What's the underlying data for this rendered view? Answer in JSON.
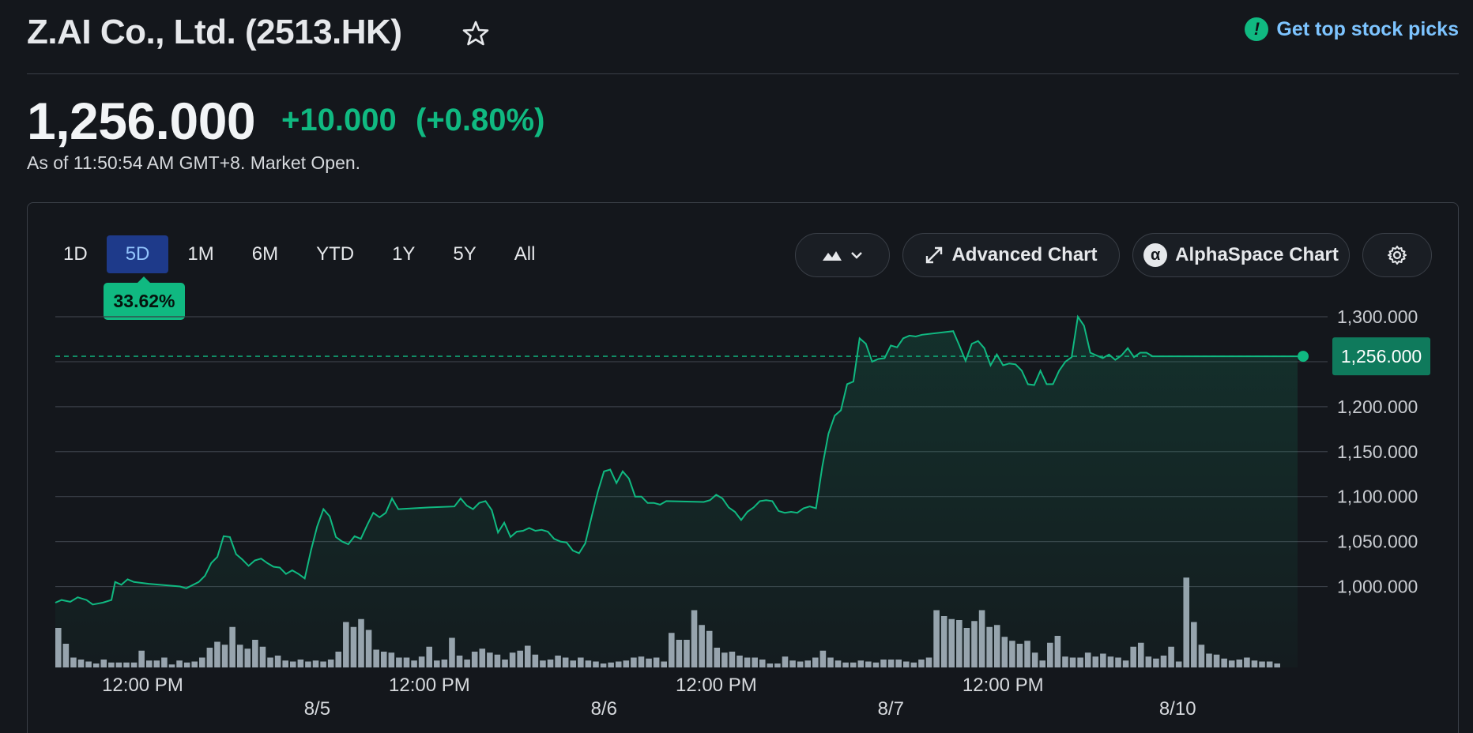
{
  "header": {
    "title": "Z.AI Co., Ltd. (2513.HK)",
    "picks_label": "Get top stock picks"
  },
  "quote": {
    "price": "1,256.000",
    "change": "+10.000",
    "change_pct": "(+0.80%)",
    "as_of": "As of 11:50:54 AM GMT+8. Market Open."
  },
  "tabs": [
    "1D",
    "5D",
    "1M",
    "6M",
    "YTD",
    "1Y",
    "5Y",
    "All"
  ],
  "active_tab": "5D",
  "tooltip": "33.62%",
  "buttons": {
    "advanced": "Advanced Chart",
    "alphaspace": "AlphaSpace Chart"
  },
  "icons": {
    "star": "star-icon",
    "picks": "exclamation-badge-icon",
    "chart_type": "mountain-chart-icon",
    "expand": "expand-arrows-icon",
    "alpha": "alpha-icon",
    "settings": "gear-icon"
  },
  "colors": {
    "up": "#10b981",
    "line": "#10b981",
    "volume": "#9ca3af",
    "grid": "#3a3f47",
    "link": "#7dc4ff",
    "active_tab_bg": "#1e3a8a",
    "active_tab_text": "#93c5fd"
  },
  "chart_data": {
    "type": "area",
    "y_ticks": [
      1000,
      1050,
      1100,
      1150,
      1200,
      1250,
      1300
    ],
    "y_tick_labels": [
      "1,000.000",
      "1,050.000",
      "1,100.000",
      "1,150.000",
      "1,200.000",
      "",
      "1,300.000"
    ],
    "ylim": [
      975,
      1300
    ],
    "current_price": 1256,
    "current_price_label": "1,256.000",
    "x_time_labels": [
      {
        "t": 0.07,
        "label": "12:00 PM"
      },
      {
        "t": 0.3,
        "label": "12:00 PM"
      },
      {
        "t": 0.53,
        "label": "12:00 PM"
      },
      {
        "t": 0.76,
        "label": "12:00 PM"
      }
    ],
    "x_date_labels": [
      {
        "t": 0.21,
        "label": "8/5"
      },
      {
        "t": 0.44,
        "label": "8/6"
      },
      {
        "t": 0.67,
        "label": "8/7"
      },
      {
        "t": 0.9,
        "label": "8/10"
      }
    ],
    "price_series": [
      [
        0.0,
        982
      ],
      [
        0.005,
        985
      ],
      [
        0.012,
        983
      ],
      [
        0.018,
        988
      ],
      [
        0.025,
        985
      ],
      [
        0.03,
        980
      ],
      [
        0.038,
        982
      ],
      [
        0.045,
        985
      ],
      [
        0.048,
        1005
      ],
      [
        0.053,
        1002
      ],
      [
        0.058,
        1008
      ],
      [
        0.063,
        1005
      ],
      [
        0.075,
        1003
      ],
      [
        0.1,
        1000
      ],
      [
        0.105,
        998
      ],
      [
        0.115,
        1005
      ],
      [
        0.12,
        1012
      ],
      [
        0.125,
        1026
      ],
      [
        0.13,
        1033
      ],
      [
        0.135,
        1056
      ],
      [
        0.14,
        1055
      ],
      [
        0.145,
        1036
      ],
      [
        0.15,
        1030
      ],
      [
        0.155,
        1023
      ],
      [
        0.16,
        1029
      ],
      [
        0.165,
        1031
      ],
      [
        0.17,
        1026
      ],
      [
        0.175,
        1022
      ],
      [
        0.18,
        1021
      ],
      [
        0.185,
        1014
      ],
      [
        0.19,
        1018
      ],
      [
        0.195,
        1014
      ],
      [
        0.2,
        1009
      ],
      [
        0.205,
        1040
      ],
      [
        0.21,
        1067
      ],
      [
        0.215,
        1086
      ],
      [
        0.22,
        1078
      ],
      [
        0.225,
        1055
      ],
      [
        0.23,
        1050
      ],
      [
        0.235,
        1047
      ],
      [
        0.24,
        1056
      ],
      [
        0.245,
        1053
      ],
      [
        0.25,
        1068
      ],
      [
        0.255,
        1082
      ],
      [
        0.26,
        1077
      ],
      [
        0.265,
        1082
      ],
      [
        0.27,
        1098
      ],
      [
        0.275,
        1086
      ],
      [
        0.3,
        1088
      ],
      [
        0.32,
        1089
      ],
      [
        0.325,
        1098
      ],
      [
        0.33,
        1090
      ],
      [
        0.335,
        1086
      ],
      [
        0.34,
        1093
      ],
      [
        0.345,
        1095
      ],
      [
        0.35,
        1085
      ],
      [
        0.355,
        1060
      ],
      [
        0.36,
        1071
      ],
      [
        0.365,
        1055
      ],
      [
        0.37,
        1061
      ],
      [
        0.375,
        1062
      ],
      [
        0.38,
        1065
      ],
      [
        0.385,
        1062
      ],
      [
        0.39,
        1063
      ],
      [
        0.395,
        1061
      ],
      [
        0.4,
        1053
      ],
      [
        0.405,
        1050
      ],
      [
        0.41,
        1049
      ],
      [
        0.415,
        1040
      ],
      [
        0.42,
        1037
      ],
      [
        0.425,
        1048
      ],
      [
        0.43,
        1077
      ],
      [
        0.435,
        1105
      ],
      [
        0.44,
        1128
      ],
      [
        0.445,
        1130
      ],
      [
        0.45,
        1115
      ],
      [
        0.455,
        1128
      ],
      [
        0.46,
        1120
      ],
      [
        0.465,
        1100
      ],
      [
        0.47,
        1100
      ],
      [
        0.475,
        1093
      ],
      [
        0.48,
        1093
      ],
      [
        0.485,
        1091
      ],
      [
        0.49,
        1095
      ],
      [
        0.52,
        1094
      ],
      [
        0.525,
        1096
      ],
      [
        0.53,
        1102
      ],
      [
        0.535,
        1098
      ],
      [
        0.54,
        1088
      ],
      [
        0.545,
        1083
      ],
      [
        0.55,
        1074
      ],
      [
        0.555,
        1083
      ],
      [
        0.56,
        1088
      ],
      [
        0.565,
        1095
      ],
      [
        0.57,
        1096
      ],
      [
        0.575,
        1095
      ],
      [
        0.58,
        1084
      ],
      [
        0.585,
        1082
      ],
      [
        0.59,
        1083
      ],
      [
        0.595,
        1082
      ],
      [
        0.6,
        1087
      ],
      [
        0.605,
        1089
      ],
      [
        0.61,
        1087
      ],
      [
        0.615,
        1133
      ],
      [
        0.62,
        1170
      ],
      [
        0.625,
        1190
      ],
      [
        0.63,
        1196
      ],
      [
        0.635,
        1225
      ],
      [
        0.64,
        1228
      ],
      [
        0.645,
        1276
      ],
      [
        0.65,
        1270
      ],
      [
        0.655,
        1250
      ],
      [
        0.66,
        1253
      ],
      [
        0.665,
        1254
      ],
      [
        0.67,
        1268
      ],
      [
        0.675,
        1266
      ],
      [
        0.68,
        1276
      ],
      [
        0.685,
        1279
      ],
      [
        0.69,
        1278
      ],
      [
        0.695,
        1280
      ],
      [
        0.72,
        1284
      ],
      [
        0.725,
        1268
      ],
      [
        0.73,
        1251
      ],
      [
        0.735,
        1270
      ],
      [
        0.74,
        1273
      ],
      [
        0.745,
        1265
      ],
      [
        0.75,
        1246
      ],
      [
        0.755,
        1258
      ],
      [
        0.76,
        1246
      ],
      [
        0.765,
        1248
      ],
      [
        0.77,
        1247
      ],
      [
        0.775,
        1240
      ],
      [
        0.78,
        1225
      ],
      [
        0.785,
        1224
      ],
      [
        0.79,
        1240
      ],
      [
        0.795,
        1225
      ],
      [
        0.8,
        1225
      ],
      [
        0.805,
        1240
      ],
      [
        0.81,
        1250
      ],
      [
        0.815,
        1255
      ],
      [
        0.82,
        1300
      ],
      [
        0.825,
        1290
      ],
      [
        0.83,
        1260
      ],
      [
        0.835,
        1257
      ],
      [
        0.84,
        1254
      ],
      [
        0.845,
        1258
      ],
      [
        0.85,
        1252
      ],
      [
        0.855,
        1257
      ],
      [
        0.86,
        1265
      ],
      [
        0.865,
        1255
      ],
      [
        0.87,
        1260
      ],
      [
        0.875,
        1260
      ],
      [
        0.88,
        1256
      ],
      [
        0.895,
        1256
      ],
      [
        0.9,
        1256
      ]
    ],
    "volume_heights": [
      0.4,
      0.24,
      0.1,
      0.08,
      0.06,
      0.04,
      0.08,
      0.05,
      0.05,
      0.05,
      0.05,
      0.17,
      0.07,
      0.07,
      0.1,
      0.03,
      0.07,
      0.05,
      0.06,
      0.1,
      0.2,
      0.26,
      0.23,
      0.41,
      0.23,
      0.19,
      0.28,
      0.21,
      0.1,
      0.12,
      0.07,
      0.06,
      0.08,
      0.06,
      0.07,
      0.06,
      0.08,
      0.16,
      0.46,
      0.41,
      0.49,
      0.38,
      0.18,
      0.16,
      0.15,
      0.1,
      0.1,
      0.07,
      0.11,
      0.21,
      0.07,
      0.08,
      0.3,
      0.12,
      0.08,
      0.16,
      0.19,
      0.15,
      0.13,
      0.08,
      0.15,
      0.17,
      0.22,
      0.13,
      0.07,
      0.08,
      0.12,
      0.1,
      0.07,
      0.1,
      0.07,
      0.06,
      0.04,
      0.05,
      0.06,
      0.07,
      0.1,
      0.11,
      0.09,
      0.1,
      0.06,
      0.35,
      0.28,
      0.28,
      0.58,
      0.43,
      0.37,
      0.2,
      0.15,
      0.16,
      0.12,
      0.1,
      0.1,
      0.08,
      0.04,
      0.04,
      0.11,
      0.07,
      0.06,
      0.07,
      0.1,
      0.17,
      0.1,
      0.07,
      0.05,
      0.05,
      0.07,
      0.06,
      0.05,
      0.08,
      0.08,
      0.08,
      0.06,
      0.05,
      0.08,
      0.1,
      0.58,
      0.52,
      0.49,
      0.48,
      0.4,
      0.47,
      0.58,
      0.41,
      0.43,
      0.31,
      0.27,
      0.24,
      0.27,
      0.15,
      0.07,
      0.25,
      0.32,
      0.11,
      0.1,
      0.1,
      0.15,
      0.11,
      0.14,
      0.11,
      0.1,
      0.07,
      0.21,
      0.25,
      0.11,
      0.09,
      0.12,
      0.21,
      0.06,
      0.91,
      0.46,
      0.23,
      0.14,
      0.13,
      0.09,
      0.07,
      0.08,
      0.1,
      0.07,
      0.06,
      0.06,
      0.04
    ]
  }
}
